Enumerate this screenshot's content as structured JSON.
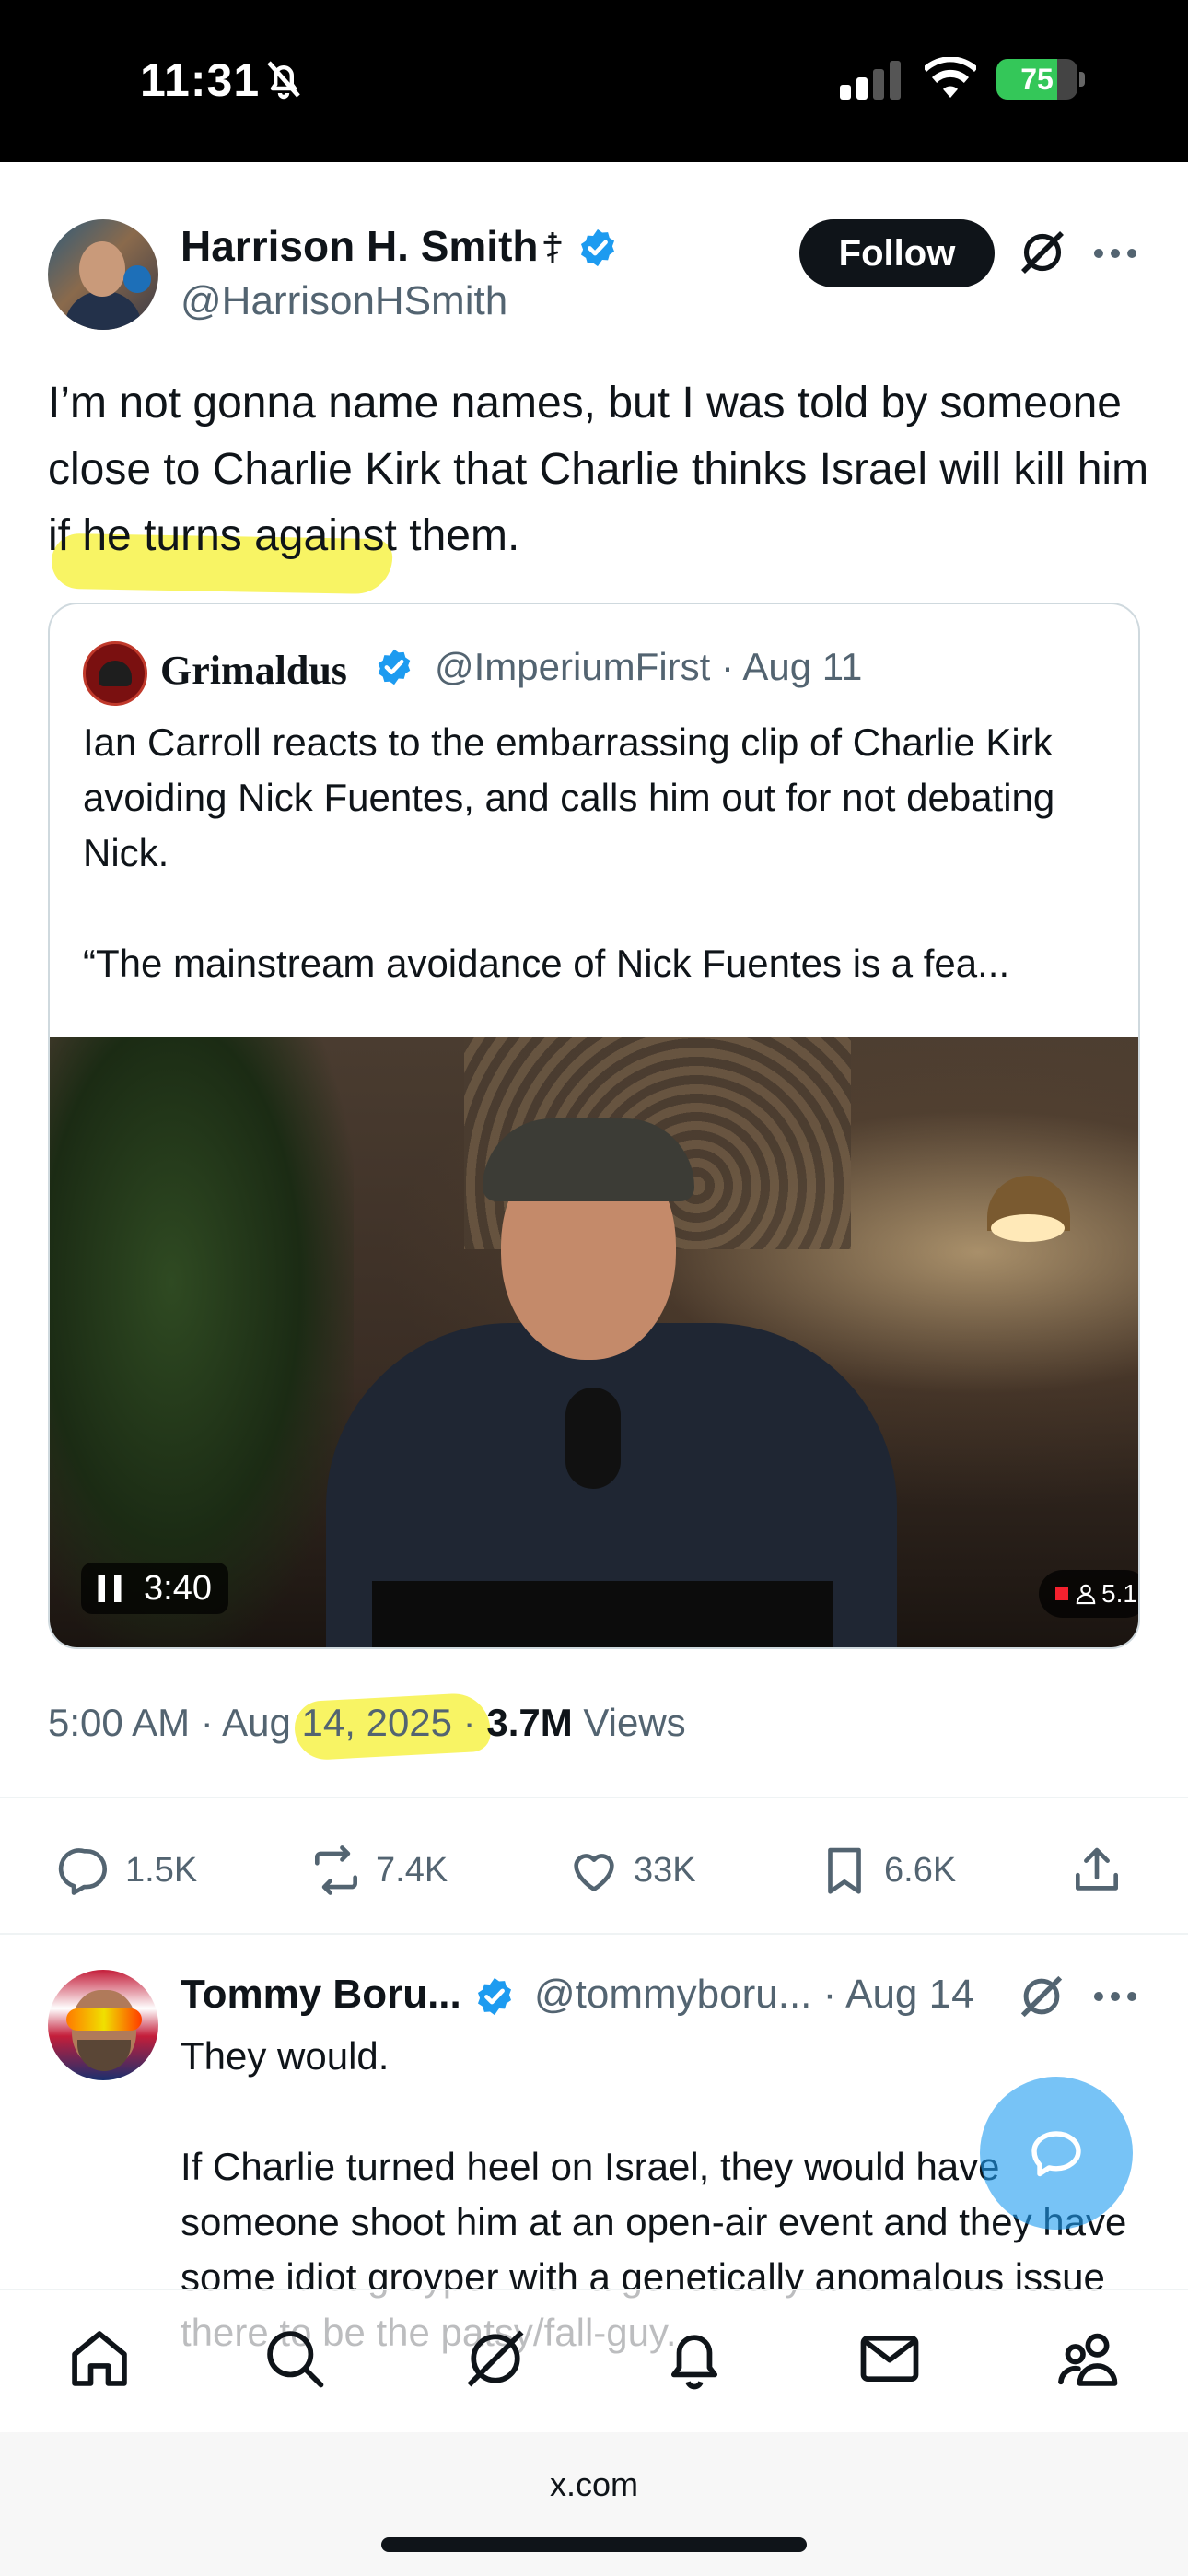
{
  "status_bar": {
    "time": "11:31",
    "battery": "75",
    "battery_level": 0.75
  },
  "tweet": {
    "author_name": "Harrison H. Smith",
    "author_handle": "@HarrisonHSmith",
    "follow_label": "Follow",
    "text": "I’m not gonna name names, but I was told by someone close to Charlie Kirk that Charlie thinks Israel will kill him if he turns against them.",
    "timestamp_time": "5:00 AM",
    "timestamp_date": "Aug 14, 2025",
    "views_count": "3.7M",
    "views_label": "Views",
    "replies": "1.5K",
    "reposts": "7.4K",
    "likes": "33K",
    "bookmarks": "6.6K"
  },
  "quote": {
    "author_name": "Grimaldus",
    "author_handle": "@ImperiumFirst",
    "date": "Aug 11",
    "text_line1": "Ian Carroll reacts to the embarrassing clip of Charlie Kirk avoiding Nick Fuentes, and calls him out for not debating Nick.",
    "text_line2": "“The mainstream avoidance of Nick Fuentes is a fea...",
    "video_duration": "3:40",
    "video_viewers": "5.1"
  },
  "reply": {
    "author_name": "Tommy Boru...",
    "author_handle": "@tommyboru...",
    "date": "Aug 14",
    "paragraph1": "They would.",
    "paragraph2": "If Charlie turned heel on Israel, they would have someone shoot him at an open-air event and they have some idiot groyper with a genetically anomalous issue there to be the patsy/fall-guy."
  },
  "browser": {
    "url": "x.com"
  },
  "tab_bar": {
    "items": [
      "home-icon",
      "search-icon",
      "grok-icon",
      "notifications-icon",
      "messages-icon",
      "communities-icon"
    ]
  },
  "colors": {
    "brand_blue": "#1d9bf0",
    "text_primary": "#0f1419",
    "text_secondary": "#536471",
    "highlight": "#f5f028"
  }
}
